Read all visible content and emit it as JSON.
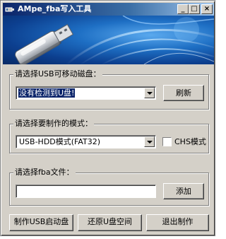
{
  "window": {
    "title": "AMpe_fba写入工具",
    "minimize_glyph": "_",
    "maximize_glyph": "□",
    "close_glyph": "×"
  },
  "usb_group": {
    "label": "请选择USB可移动磁盘：",
    "selected_value": "没有检测到U盘!",
    "refresh_label": "刷新"
  },
  "mode_group": {
    "label": "请选择要制作的模式：",
    "selected_value": "USB-HDD模式(FAT32)",
    "chs_label": "CHS模式",
    "chs_checked": false
  },
  "fba_group": {
    "label": "请选择fba文件：",
    "file_value": "",
    "add_label": "添加"
  },
  "actions": {
    "make_usb_label": "制作USB启动盘",
    "restore_label": "还原U盘空间",
    "exit_label": "退出制作"
  },
  "icons": {
    "app": "usb-drive-icon",
    "banner": "usb-flash-drive-icon"
  },
  "colors": {
    "titlebar_start": "#0a246a",
    "titlebar_end": "#a6caf0",
    "banner_blue": "#1e6fc4",
    "face": "#d4d0c8",
    "selection": "#0a246a"
  }
}
